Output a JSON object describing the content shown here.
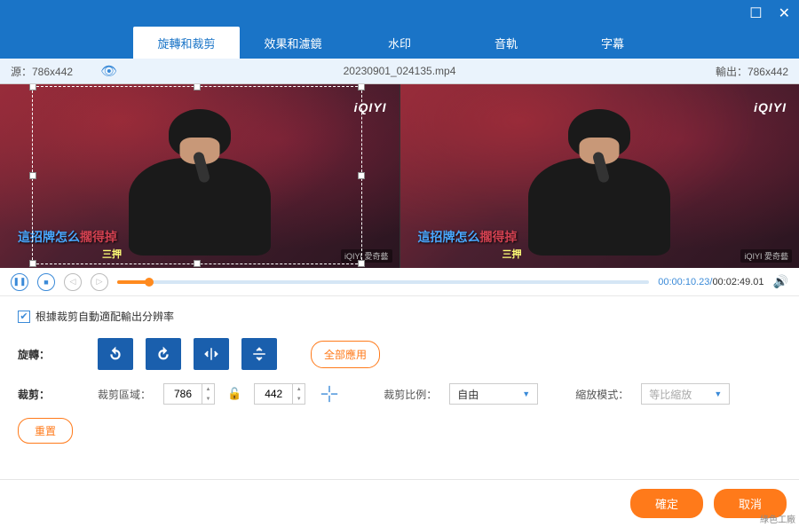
{
  "window": {
    "maximize": "☐",
    "close": "✕"
  },
  "tabs": [
    "旋轉和裁剪",
    "效果和濾鏡",
    "水印",
    "音軌",
    "字幕"
  ],
  "infobar": {
    "source_label": "源：786x442",
    "filename": "20230901_024135.mp4",
    "output_label": "輸出：786x442"
  },
  "preview": {
    "logo": "iQIYI",
    "subtitle_blue": "這招牌怎么",
    "subtitle_red": "擱得掉",
    "sub2": "三押",
    "watermark_small": "iQIYI 愛奇藝"
  },
  "playback": {
    "current": "00:00:10.23",
    "total": "00:02:49.01"
  },
  "controls": {
    "auto_fit_label": "根據裁剪自動適配輸出分辨率",
    "rotate_label": "旋轉：",
    "apply_all": "全部應用",
    "crop_label": "裁剪：",
    "crop_area_label": "裁剪區域：",
    "crop_w": "786",
    "crop_h": "442",
    "crop_ratio_label": "裁剪比例：",
    "crop_ratio_value": "自由",
    "zoom_mode_label": "縮放模式：",
    "zoom_mode_value": "等比縮放",
    "reset": "重置"
  },
  "footer": {
    "ok": "確定",
    "cancel": "取消"
  },
  "corner": "綠色工廠"
}
